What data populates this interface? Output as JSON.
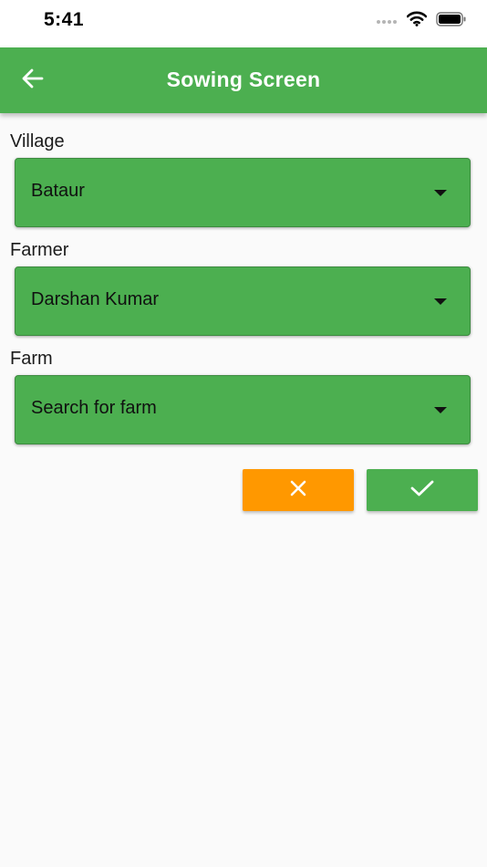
{
  "status_bar": {
    "time": "5:41"
  },
  "app_bar": {
    "title": "Sowing Screen",
    "back_icon": "arrow-left-icon"
  },
  "form": {
    "village": {
      "label": "Village",
      "value": "Bataur"
    },
    "farmer": {
      "label": "Farmer",
      "value": "Darshan Kumar"
    },
    "farm": {
      "label": "Farm",
      "placeholder": "Search for farm"
    }
  },
  "actions": {
    "cancel_icon": "close-icon",
    "confirm_icon": "check-icon"
  },
  "colors": {
    "primary": "#4caf50",
    "accent": "#ff9800",
    "background": "#fafafa"
  }
}
